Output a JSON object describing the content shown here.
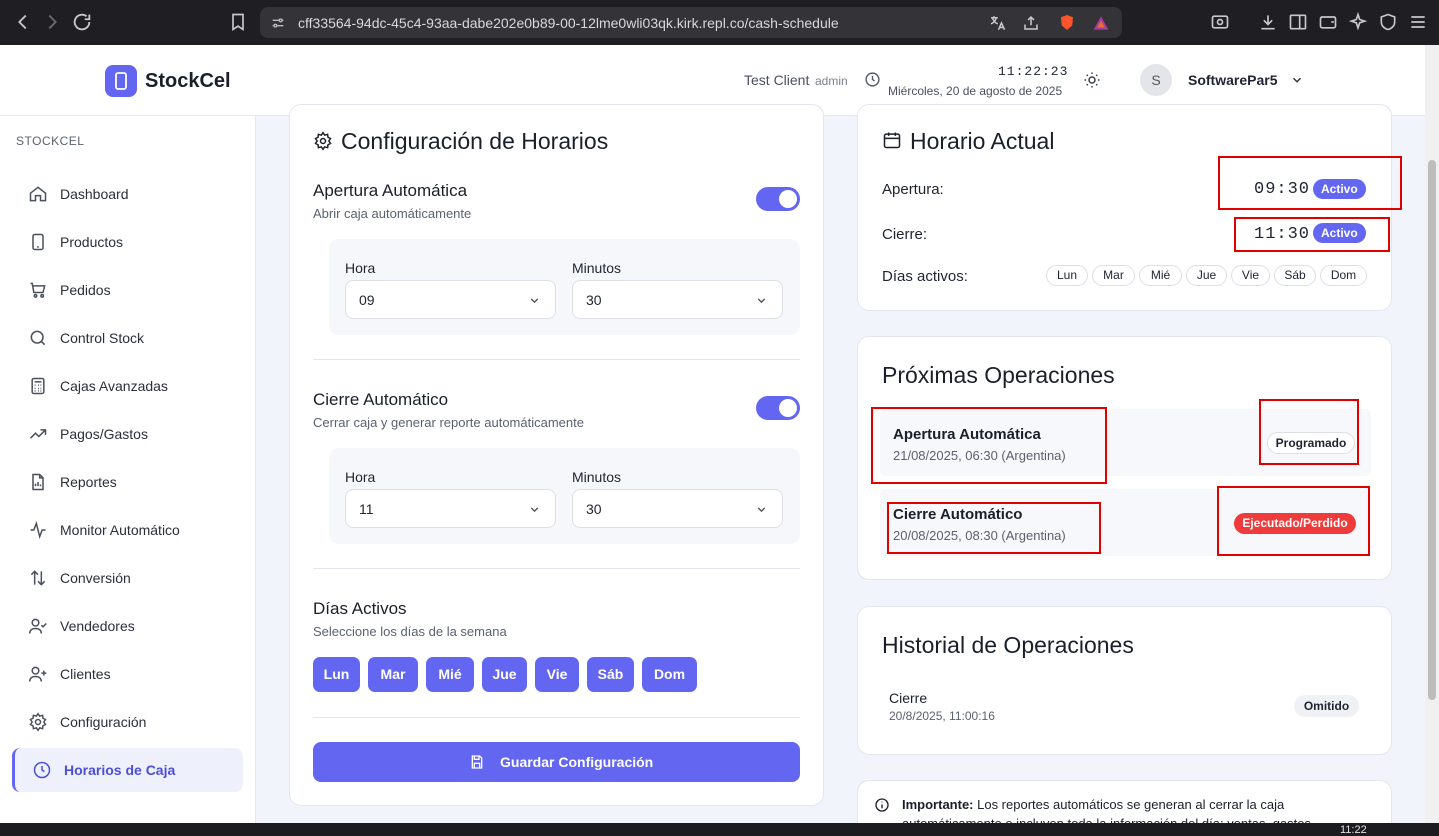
{
  "browser": {
    "url": "cff33564-94dc-45c4-93aa-dabe202e0b89-00-12lme0wli03qk.kirk.repl.co/cash-schedule"
  },
  "header": {
    "brand": "StockCel",
    "client": "Test Client",
    "role": "admin",
    "time": "11:22:23",
    "date": "Miércoles, 20 de agosto de 2025",
    "avatar_initial": "S",
    "username": "SoftwarePar5"
  },
  "sidebar": {
    "title": "STOCKCEL",
    "items": [
      {
        "label": "Dashboard",
        "icon": "home-icon"
      },
      {
        "label": "Productos",
        "icon": "phone-icon"
      },
      {
        "label": "Pedidos",
        "icon": "cart-icon"
      },
      {
        "label": "Control Stock",
        "icon": "search-icon"
      },
      {
        "label": "Cajas Avanzadas",
        "icon": "calculator-icon"
      },
      {
        "label": "Pagos/Gastos",
        "icon": "trending-up-icon"
      },
      {
        "label": "Reportes",
        "icon": "file-chart-icon"
      },
      {
        "label": "Monitor Automático",
        "icon": "activity-icon"
      },
      {
        "label": "Conversión",
        "icon": "arrows-up-down-icon"
      },
      {
        "label": "Vendedores",
        "icon": "user-check-icon"
      },
      {
        "label": "Clientes",
        "icon": "user-plus-icon"
      },
      {
        "label": "Configuración",
        "icon": "gear-icon"
      },
      {
        "label": "Horarios de Caja",
        "icon": "clock-icon",
        "active": true
      }
    ]
  },
  "config": {
    "title": "Configuración de Horarios",
    "apertura": {
      "title": "Apertura Automática",
      "subtitle": "Abrir caja automáticamente",
      "enabled": true,
      "hora_label": "Hora",
      "hora": "09",
      "minutos_label": "Minutos",
      "minutos": "30"
    },
    "cierre": {
      "title": "Cierre Automático",
      "subtitle": "Cerrar caja y generar reporte automáticamente",
      "enabled": true,
      "hora_label": "Hora",
      "hora": "11",
      "minutos_label": "Minutos",
      "minutos": "30"
    },
    "dias": {
      "title": "Días Activos",
      "subtitle": "Seleccione los días de la semana",
      "days": [
        "Lun",
        "Mar",
        "Mié",
        "Jue",
        "Vie",
        "Sáb",
        "Dom"
      ]
    },
    "save_label": "Guardar Configuración"
  },
  "horario": {
    "title": "Horario Actual",
    "apertura_label": "Apertura:",
    "apertura_time": "09:30",
    "apertura_status": "Activo",
    "cierre_label": "Cierre:",
    "cierre_time": "11:30",
    "cierre_status": "Activo",
    "dias_label": "Días activos:",
    "dias": [
      "Lun",
      "Mar",
      "Mié",
      "Jue",
      "Vie",
      "Sáb",
      "Dom"
    ]
  },
  "proximas": {
    "title": "Próximas Operaciones",
    "items": [
      {
        "title": "Apertura Automática",
        "subtitle": "21/08/2025, 06:30 (Argentina)",
        "status": "Programado"
      },
      {
        "title": "Cierre Automático",
        "subtitle": "20/08/2025, 08:30 (Argentina)",
        "status": "Ejecutado/Perdido"
      }
    ]
  },
  "historial": {
    "title": "Historial de Operaciones",
    "items": [
      {
        "title": "Cierre",
        "subtitle": "20/8/2025, 11:00:16",
        "status": "Omitido"
      }
    ]
  },
  "note": {
    "bold": "Importante:",
    "text": " Los reportes automáticos se generan al cerrar la caja",
    "text2": "automáticamente e incluyen toda la información del día: ventas, gastos"
  },
  "taskbar": {
    "time": "11:22"
  },
  "colors": {
    "accent": "#6366f1",
    "danger": "#ef3b3b",
    "highlight_box": "#e00000"
  }
}
